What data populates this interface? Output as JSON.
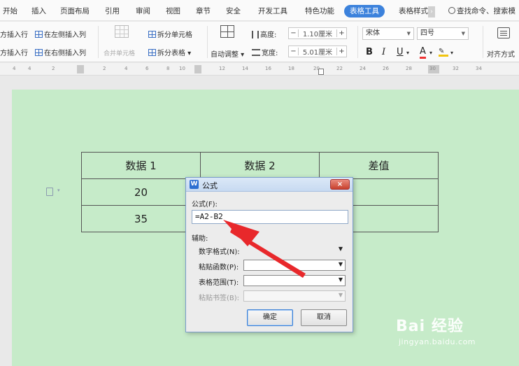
{
  "menu": {
    "items": [
      "开始",
      "插入",
      "页面布局",
      "引用",
      "审阅",
      "视图",
      "章节",
      "安全",
      "开发工具",
      "特色功能"
    ],
    "active_tab": "表格工具",
    "style_tab": "表格样式",
    "search": "查找命令、搜索模"
  },
  "ribbon": {
    "insert_row_above": "方插入行",
    "insert_row_below": "方插入行",
    "insert_col_left": "在左侧插入列",
    "insert_col_right": "在右侧插入列",
    "merge_cells": "合并单元格",
    "split_cells": "拆分单元格",
    "split_table": "拆分表格",
    "auto_fit": "自动调整",
    "height_label": "高度:",
    "height_value": "1.10厘米",
    "width_label": "宽度:",
    "width_value": "5.01厘米",
    "font_name": "宋体",
    "font_size": "四号",
    "bold": "B",
    "italic": "I",
    "underline": "U",
    "font_color": "A",
    "align": "对齐方式",
    "minus": "−",
    "plus": "+"
  },
  "ruler": {
    "ticks": [
      "4",
      "2",
      "2",
      "4",
      "6",
      "8",
      "10",
      "12",
      "14",
      "16",
      "18",
      "20",
      "22",
      "24",
      "26",
      "28",
      "30",
      "32",
      "34"
    ]
  },
  "document": {
    "table": [
      [
        "数据 1",
        "数据 2",
        "差值"
      ],
      [
        "20",
        "",
        ""
      ],
      [
        "35",
        "",
        ""
      ]
    ]
  },
  "dialog": {
    "title": "公式",
    "formula_label": "公式(F):",
    "formula_value": "=A2-B2",
    "aux_label": "辅助:",
    "number_format_label": "数字格式(N):",
    "paste_function_label": "粘贴函数(P):",
    "table_range_label": "表格范围(T):",
    "paste_bookmark_label": "粘贴书签(B):",
    "ok": "确定",
    "cancel": "取消",
    "close": "×"
  },
  "watermark": {
    "logo": "Bai 经验",
    "url": "jingyan.baidu.com"
  },
  "colors": {
    "page_background": "#c6ebc9",
    "accent": "#3c82dc",
    "annotation_arrow": "#e8282b"
  },
  "icons": [
    "search-icon",
    "insert-column-left-icon",
    "insert-column-right-icon",
    "merge-cells-icon",
    "split-cells-icon",
    "split-table-icon",
    "auto-fit-icon",
    "row-height-icon",
    "column-width-icon",
    "align-icon",
    "paragraph-handle-icon",
    "wps-dialog-icon",
    "close-icon"
  ]
}
